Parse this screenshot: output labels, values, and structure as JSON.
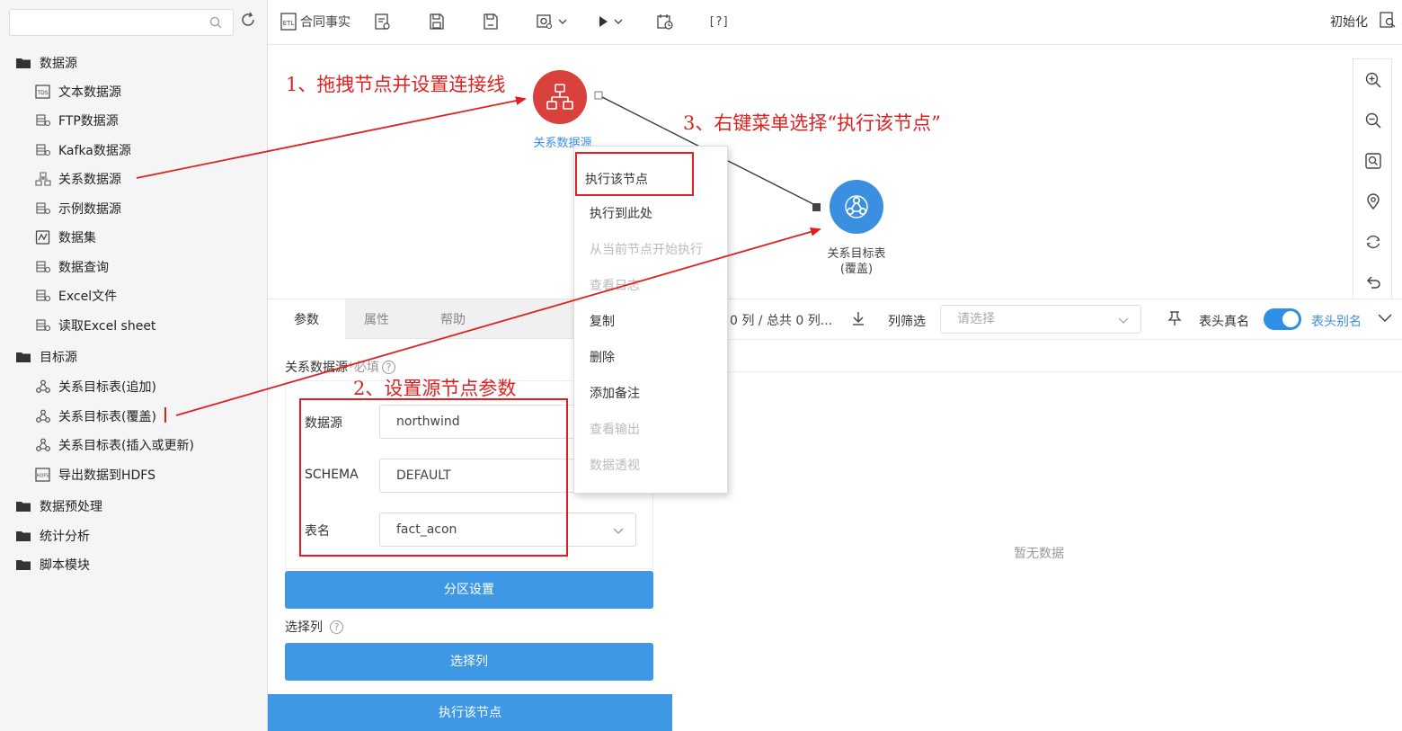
{
  "sidebar": {
    "search_placeholder": "",
    "tree": [
      {
        "label": "数据源",
        "type": "folder"
      },
      {
        "label": "文本数据源",
        "type": "leaf"
      },
      {
        "label": "FTP数据源",
        "type": "leaf"
      },
      {
        "label": "Kafka数据源",
        "type": "leaf"
      },
      {
        "label": "关系数据源",
        "type": "leaf"
      },
      {
        "label": "示例数据源",
        "type": "leaf"
      },
      {
        "label": "数据集",
        "type": "leaf"
      },
      {
        "label": "数据查询",
        "type": "leaf"
      },
      {
        "label": "Excel文件",
        "type": "leaf"
      },
      {
        "label": "读取Excel sheet",
        "type": "leaf"
      },
      {
        "label": "目标源",
        "type": "folder"
      },
      {
        "label": "关系目标表(追加)",
        "type": "leaf"
      },
      {
        "label": "关系目标表(覆盖)",
        "type": "leaf"
      },
      {
        "label": "关系目标表(插入或更新)",
        "type": "leaf"
      },
      {
        "label": "导出数据到HDFS",
        "type": "leaf"
      },
      {
        "label": "数据预处理",
        "type": "folder"
      },
      {
        "label": "统计分析",
        "type": "folder"
      },
      {
        "label": "脚本模块",
        "type": "folder"
      }
    ]
  },
  "toolbar": {
    "etl_badge": "ETL",
    "title": "合同事实",
    "help_label": "[?]",
    "init_label": "初始化"
  },
  "canvas": {
    "source_node_label": "关系数据源",
    "target_node_label_line1": "关系目标表",
    "target_node_label_line2": "(覆盖)"
  },
  "context_menu": {
    "items": [
      {
        "label": "执行该节点",
        "enabled": true
      },
      {
        "label": "执行到此处",
        "enabled": true
      },
      {
        "label": "从当前节点开始执行",
        "enabled": false
      },
      {
        "label": "查看日志",
        "enabled": false
      },
      {
        "label": "复制",
        "enabled": true
      },
      {
        "label": "删除",
        "enabled": true
      },
      {
        "label": "添加备注",
        "enabled": true
      },
      {
        "label": "查看输出",
        "enabled": false
      },
      {
        "label": "数据透视",
        "enabled": false
      }
    ]
  },
  "panel": {
    "tabs": [
      "参数",
      "属性",
      "帮助"
    ],
    "source_label": "关系数据源",
    "required_note": "*必填",
    "fields": [
      {
        "label": "数据源",
        "value": "northwind"
      },
      {
        "label": "SCHEMA",
        "value": "DEFAULT"
      },
      {
        "label": "表名",
        "value": "fact_acon"
      }
    ],
    "partition_btn": "分区设置",
    "select_col_label": "选择列",
    "select_col_btn": "选择列",
    "exec_btn": "执行该节点"
  },
  "result": {
    "col_info": "0 列 / 总共 0 列...",
    "filter_label": "列筛选",
    "filter_placeholder": "请选择",
    "header_real": "表头真名",
    "header_alias": "表头别名",
    "no_data": "暂无数据"
  },
  "annotations": {
    "step1": "1、拖拽节点并设置连接线",
    "step2": "2、设置源节点参数",
    "step3": "3、右键菜单选择“执行该节点”"
  },
  "colors": {
    "accent": "#3e98e6",
    "source_node": "#d9413c",
    "target_node": "#3b8fe0",
    "annotation": "#e02020"
  }
}
